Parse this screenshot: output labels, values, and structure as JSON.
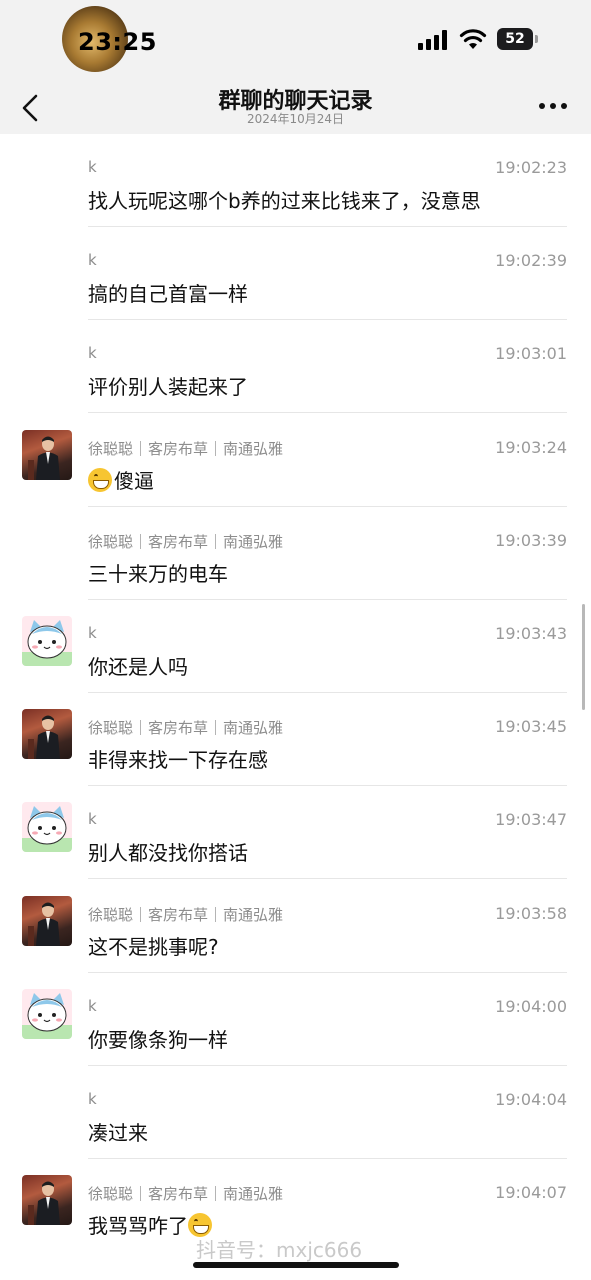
{
  "status_bar": {
    "time": "23:25",
    "battery": "52"
  },
  "nav": {
    "title": "群聊的聊天记录",
    "subtitle": "2024年10月24日",
    "back_icon": "chevron-left-icon",
    "more_icon": "more-dots-icon"
  },
  "messages": [
    {
      "sender": "k",
      "time": "19:02:23",
      "text": "找人玩呢这哪个b养的过来比钱来了，没意思",
      "avatar": "none"
    },
    {
      "sender": "k",
      "time": "19:02:39",
      "text": "搞的自己首富一样",
      "avatar": "none"
    },
    {
      "sender": "k",
      "time": "19:03:01",
      "text": "评价别人装起来了",
      "avatar": "none"
    },
    {
      "sender": "徐聪聪｜客房布草｜南通弘雅",
      "time": "19:03:24",
      "text": "傻逼",
      "emoji": "grin-emoji",
      "emoji_position": "before",
      "avatar": "man"
    },
    {
      "sender": "徐聪聪｜客房布草｜南通弘雅",
      "time": "19:03:39",
      "text": "三十来万的电车",
      "avatar": "none"
    },
    {
      "sender": "k",
      "time": "19:03:43",
      "text": "你还是人吗",
      "avatar": "cat"
    },
    {
      "sender": "徐聪聪｜客房布草｜南通弘雅",
      "time": "19:03:45",
      "text": "非得来找一下存在感",
      "avatar": "man"
    },
    {
      "sender": "k",
      "time": "19:03:47",
      "text": "别人都没找你搭话",
      "avatar": "cat"
    },
    {
      "sender": "徐聪聪｜客房布草｜南通弘雅",
      "time": "19:03:58",
      "text": "这不是挑事呢?",
      "avatar": "man"
    },
    {
      "sender": "k",
      "time": "19:04:00",
      "text": "你要像条狗一样",
      "avatar": "cat"
    },
    {
      "sender": "k",
      "time": "19:04:04",
      "text": "凑过来",
      "avatar": "none"
    },
    {
      "sender": "徐聪聪｜客房布草｜南通弘雅",
      "time": "19:04:07",
      "text": "我骂骂咋了",
      "emoji": "grin-emoji",
      "emoji_position": "after",
      "avatar": "man"
    }
  ],
  "watermark": "抖音号：mxjc666"
}
